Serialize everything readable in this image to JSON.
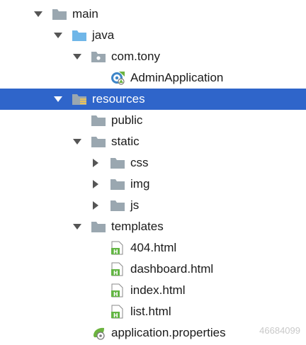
{
  "tree": {
    "items": [
      {
        "label": "main",
        "icon": "folder-icon",
        "arrow": "expanded",
        "selected": false
      },
      {
        "label": "java",
        "icon": "source-folder-icon",
        "arrow": "expanded",
        "selected": false
      },
      {
        "label": "com.tony",
        "icon": "package-icon",
        "arrow": "expanded",
        "selected": false
      },
      {
        "label": "AdminApplication",
        "icon": "spring-boot-class-icon",
        "arrow": "none",
        "selected": false
      },
      {
        "label": "resources",
        "icon": "resources-folder-icon",
        "arrow": "expanded",
        "selected": true
      },
      {
        "label": "public",
        "icon": "folder-icon",
        "arrow": "none",
        "selected": false
      },
      {
        "label": "static",
        "icon": "folder-icon",
        "arrow": "expanded",
        "selected": false
      },
      {
        "label": "css",
        "icon": "folder-icon",
        "arrow": "collapsed",
        "selected": false
      },
      {
        "label": "img",
        "icon": "folder-icon",
        "arrow": "collapsed",
        "selected": false
      },
      {
        "label": "js",
        "icon": "folder-icon",
        "arrow": "collapsed",
        "selected": false
      },
      {
        "label": "templates",
        "icon": "folder-icon",
        "arrow": "expanded",
        "selected": false
      },
      {
        "label": "404.html",
        "icon": "html-file-icon",
        "arrow": "none",
        "selected": false
      },
      {
        "label": "dashboard.html",
        "icon": "html-file-icon",
        "arrow": "none",
        "selected": false
      },
      {
        "label": "index.html",
        "icon": "html-file-icon",
        "arrow": "none",
        "selected": false
      },
      {
        "label": "list.html",
        "icon": "html-file-icon",
        "arrow": "none",
        "selected": false
      },
      {
        "label": "application.properties",
        "icon": "spring-properties-icon",
        "arrow": "none",
        "selected": false
      }
    ]
  },
  "watermark": {
    "text": "46684099"
  },
  "colors": {
    "selection": "#2f65ca",
    "folder": "#9aa7b0",
    "source_folder": "#6fb6e8",
    "html_badge": "#62b543",
    "spring": "#6cb33f"
  }
}
